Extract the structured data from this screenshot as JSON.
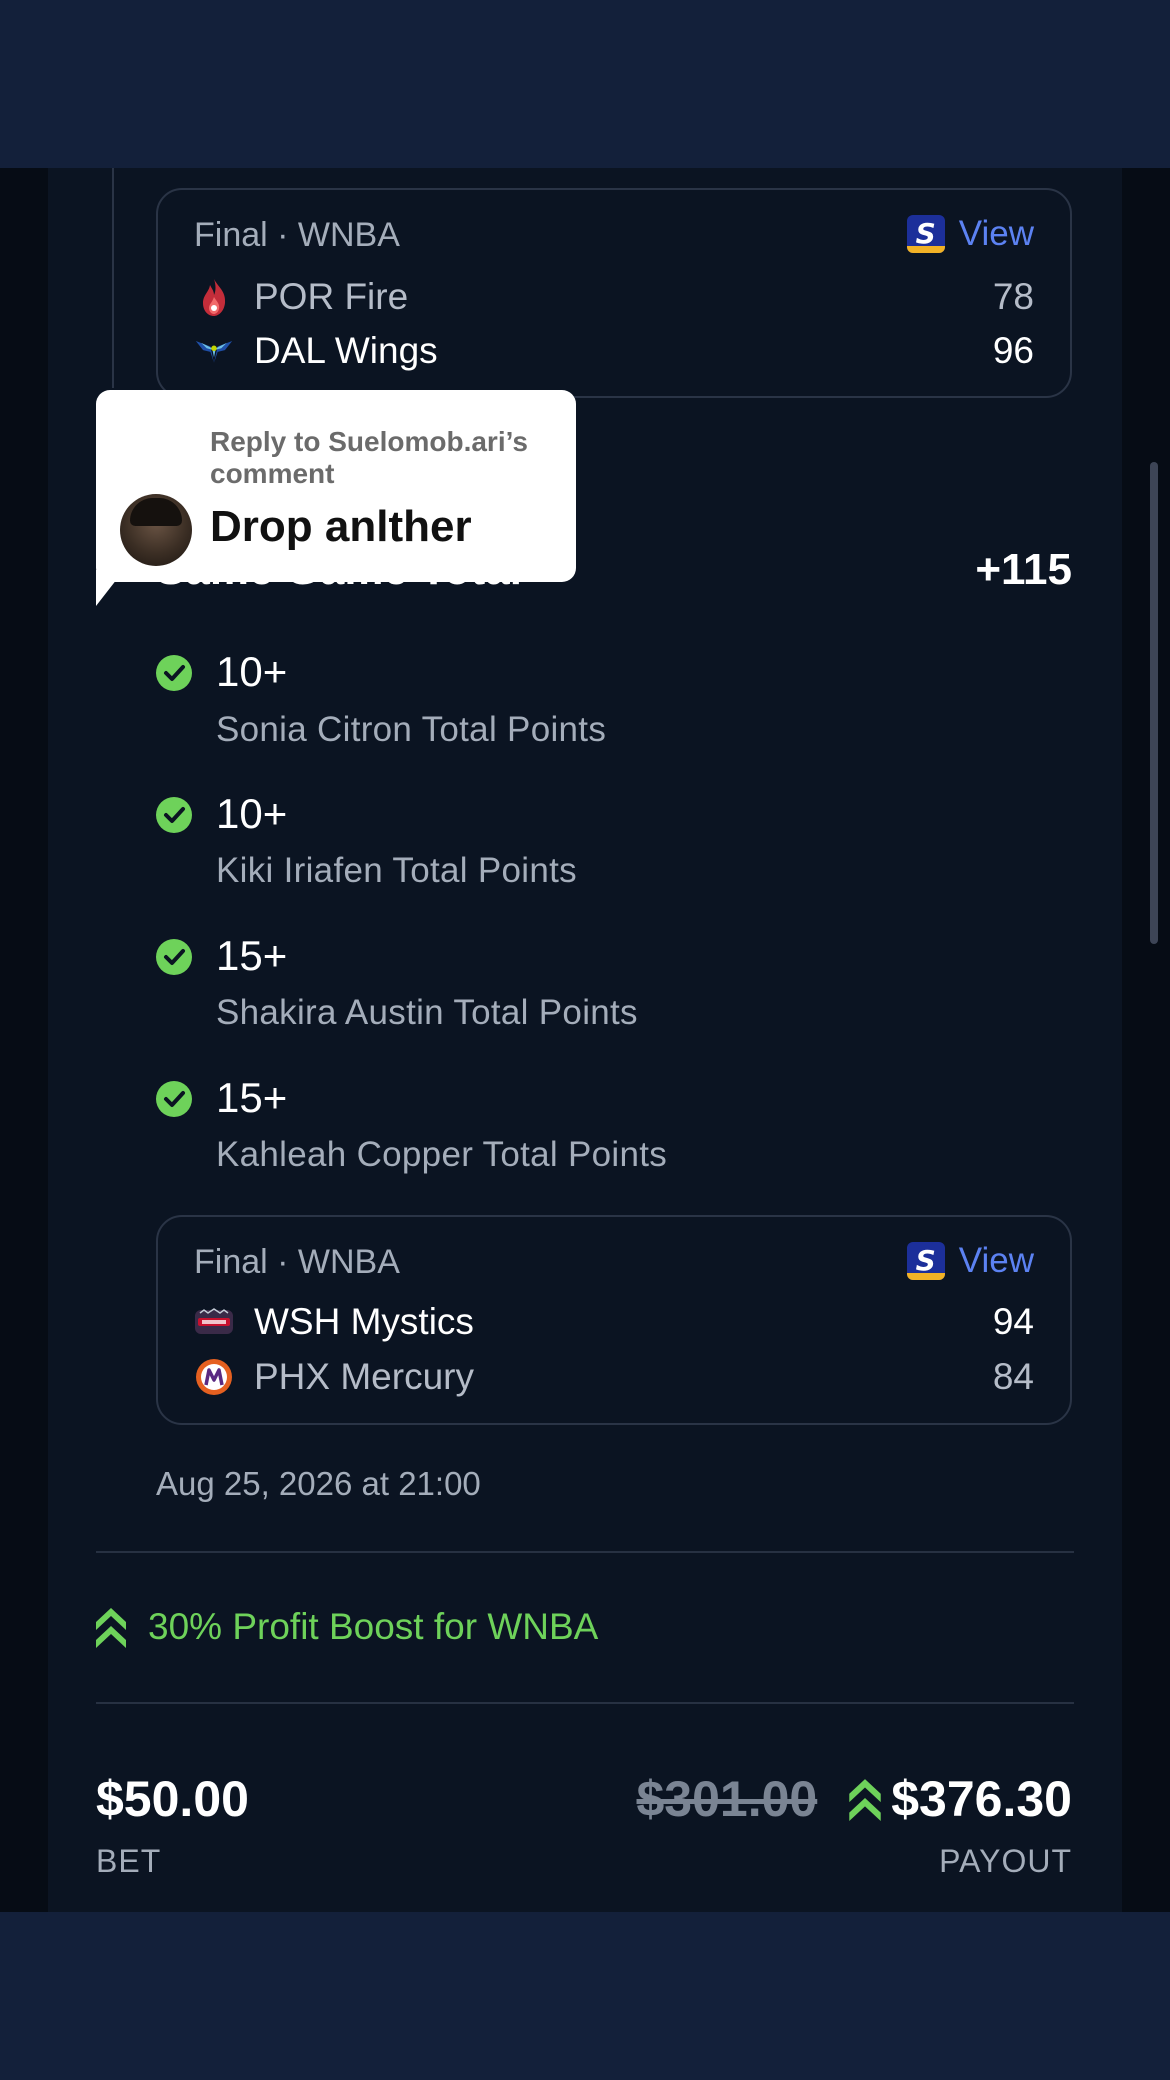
{
  "colors": {
    "page_bg": "#13203a",
    "card_bg": "#0b1422",
    "accent_link": "#5c82f2",
    "success": "#6ed25a",
    "muted_text": "#a4adba"
  },
  "games": [
    {
      "status": "Final · WNBA",
      "view_label": "View",
      "view_icon": "sportsbook-s-logo-icon",
      "teams": [
        {
          "name": "POR Fire",
          "score": "78",
          "logo": "fire-logo-icon"
        },
        {
          "name": "DAL Wings",
          "score": "96",
          "logo": "wings-logo-icon"
        }
      ]
    },
    {
      "status": "Final · WNBA",
      "view_label": "View",
      "view_icon": "sportsbook-s-logo-icon",
      "teams": [
        {
          "name": "WSH Mystics",
          "score": "94",
          "logo": "mystics-logo-icon"
        },
        {
          "name": "PHX Mercury",
          "score": "84",
          "logo": "mercury-logo-icon"
        }
      ]
    }
  ],
  "selection": {
    "title": "Same Game Total",
    "odds": "+115"
  },
  "legs": [
    {
      "value": "10+",
      "description": "Sonia Citron Total Points",
      "status": "won"
    },
    {
      "value": "10+",
      "description": "Kiki Iriafen Total Points",
      "status": "won"
    },
    {
      "value": "15+",
      "description": "Shakira Austin Total Points",
      "status": "won"
    },
    {
      "value": "15+",
      "description": "Kahleah Copper Total Points",
      "status": "won"
    }
  ],
  "timestamp": "Aug 25, 2026 at 21:00",
  "boost": {
    "text": "30% Profit Boost for WNBA",
    "icon": "double-chevron-up-icon"
  },
  "bet": {
    "amount": "$50.00",
    "label": "BET"
  },
  "payout": {
    "original": "$301.00",
    "boosted": "$376.30",
    "label": "PAYOUT"
  },
  "reply_popup": {
    "reply_to": "Reply to Suelomob.ari’s comment",
    "text": "Drop anlther"
  }
}
